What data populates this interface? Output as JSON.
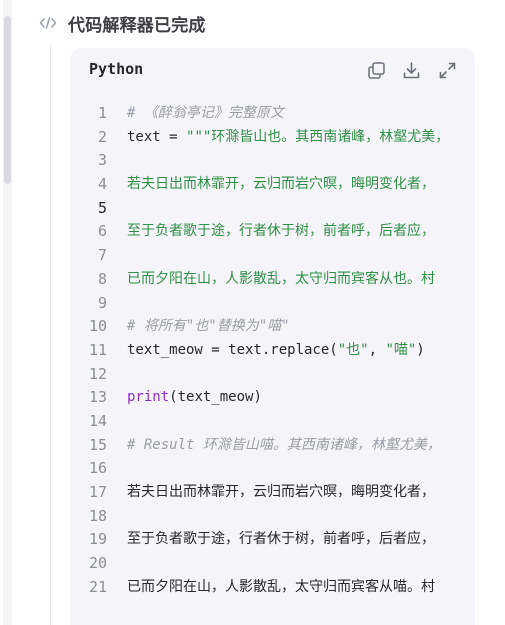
{
  "header": {
    "title": "代码解释器已完成",
    "icon": "code-tag-icon"
  },
  "code_block": {
    "language": "Python",
    "actions": [
      "copy-icon",
      "download-icon",
      "expand-icon"
    ],
    "active_line": 5,
    "lines": [
      {
        "n": "1",
        "tokens": [
          {
            "t": "comment",
            "v": "# 《醉翁亭记》完整原文"
          }
        ]
      },
      {
        "n": "2",
        "tokens": [
          {
            "t": "plain",
            "v": "text = "
          },
          {
            "t": "string",
            "v": "\"\"\"环滁皆山也。其西南诸峰，林壑尤美，"
          }
        ]
      },
      {
        "n": "3",
        "tokens": []
      },
      {
        "n": "4",
        "tokens": [
          {
            "t": "string",
            "v": "若夫日出而林霏开，云归而岩穴暝，晦明变化者，"
          }
        ]
      },
      {
        "n": "5",
        "tokens": []
      },
      {
        "n": "6",
        "tokens": [
          {
            "t": "string",
            "v": "至于负者歌于途，行者休于树，前者呼，后者应，"
          }
        ]
      },
      {
        "n": "7",
        "tokens": []
      },
      {
        "n": "8",
        "tokens": [
          {
            "t": "string",
            "v": "已而夕阳在山，人影散乱，太守归而宾客从也。村"
          }
        ]
      },
      {
        "n": "9",
        "tokens": []
      },
      {
        "n": "10",
        "tokens": [
          {
            "t": "comment",
            "v": "# 将所有\"也\"替换为\"喵\""
          }
        ]
      },
      {
        "n": "11",
        "tokens": [
          {
            "t": "plain",
            "v": "text_meow = text.replace("
          },
          {
            "t": "string",
            "v": "\"也\""
          },
          {
            "t": "plain",
            "v": ", "
          },
          {
            "t": "string",
            "v": "\"喵\""
          },
          {
            "t": "plain",
            "v": ")"
          }
        ]
      },
      {
        "n": "12",
        "tokens": []
      },
      {
        "n": "13",
        "tokens": [
          {
            "t": "keyword",
            "v": "print"
          },
          {
            "t": "plain",
            "v": "(text_meow)"
          }
        ]
      },
      {
        "n": "14",
        "tokens": []
      },
      {
        "n": "15",
        "tokens": [
          {
            "t": "comment",
            "v": "# Result 环滁皆山喵。其西南诸峰，林壑尤美，"
          }
        ]
      },
      {
        "n": "16",
        "tokens": []
      },
      {
        "n": "17",
        "tokens": [
          {
            "t": "plain",
            "v": "若夫日出而林霏开，云归而岩穴暝，晦明变化者，"
          }
        ]
      },
      {
        "n": "18",
        "tokens": []
      },
      {
        "n": "19",
        "tokens": [
          {
            "t": "plain",
            "v": "至于负者歌于途，行者休于树，前者呼，后者应，"
          }
        ]
      },
      {
        "n": "20",
        "tokens": []
      },
      {
        "n": "21",
        "tokens": [
          {
            "t": "plain",
            "v": "已而夕阳在山，人影散乱，太守归而宾客从喵。村"
          }
        ]
      }
    ]
  }
}
